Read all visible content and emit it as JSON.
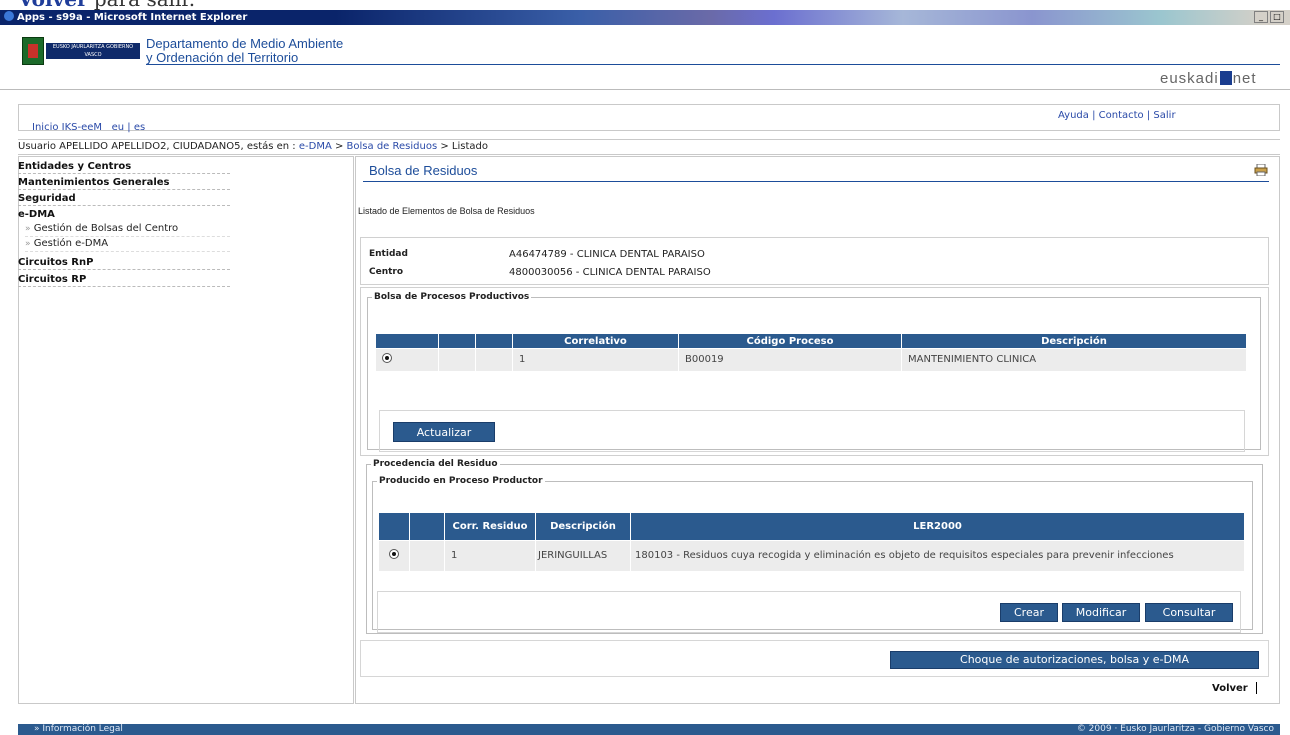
{
  "stray_text": {
    "bold": "Volver",
    "rest": " para salir."
  },
  "window": {
    "title": "Apps - s99a - Microsoft Internet Explorer"
  },
  "header": {
    "logo_text": "EUSKO JAURLARITZA GOBIERNO VASCO",
    "dept_line1": "Departamento de Medio Ambiente",
    "dept_line2": "y Ordenación del Territorio",
    "brand_left": "euskadi",
    "brand_right": "net"
  },
  "topnav": {
    "home": "Inicio IKS-eeM",
    "lang_eu": "eu",
    "lang_es": "es",
    "help": "Ayuda",
    "contact": "Contacto",
    "exit": "Salir"
  },
  "breadcrumb": {
    "prefix": "Usuario APELLIDO APELLIDO2, CIUDADANO5, estás en : ",
    "items": [
      "e-DMA",
      "Bolsa de Residuos"
    ],
    "current": "Listado"
  },
  "sidebar": {
    "items": [
      {
        "label": "Entidades y Centros"
      },
      {
        "label": "Mantenimientos Generales"
      },
      {
        "label": "Seguridad"
      },
      {
        "label": "e-DMA"
      },
      {
        "label": "Gestión de Bolsas del Centro"
      },
      {
        "label": "Gestión e-DMA"
      },
      {
        "label": "Circuitos RnP"
      },
      {
        "label": "Circuitos RP"
      }
    ]
  },
  "main": {
    "title": "Bolsa de Residuos",
    "subtitle": "Listado de Elementos de Bolsa de Residuos",
    "entity": {
      "label": "Entidad",
      "value": "A46474789 - CLINICA DENTAL PARAISO"
    },
    "center": {
      "label": "Centro",
      "value": "4800030056 - CLINICA DENTAL PARAISO"
    },
    "processes": {
      "legend": "Bolsa de Procesos Productivos",
      "columns": [
        "",
        "",
        "",
        "Correlativo",
        "Código Proceso",
        "Descripción"
      ],
      "rows": [
        [
          "1",
          "B00019",
          "MANTENIMIENTO CLINICA"
        ]
      ],
      "update_button": "Actualizar"
    },
    "origin": {
      "legend": "Procedencia del Residuo",
      "sub_legend": "Producido en Proceso Productor",
      "columns": [
        "",
        "",
        "Corr. Residuo",
        "Descripción",
        "LER2000"
      ],
      "rows": [
        [
          "1",
          "JERINGUILLAS",
          "180103 - Residuos cuya recogida y eliminación es objeto de requisitos especiales para prevenir infecciones"
        ]
      ],
      "buttons": {
        "create": "Crear",
        "modify": "Modificar",
        "consult": "Consultar"
      }
    },
    "check_button": "Choque de autorizaciones, bolsa y e-DMA",
    "back_link": "Volver"
  },
  "footer": {
    "legal": "Información Legal",
    "copyright": "© 2009 · Eusko Jaurlaritza - Gobierno Vasco"
  }
}
